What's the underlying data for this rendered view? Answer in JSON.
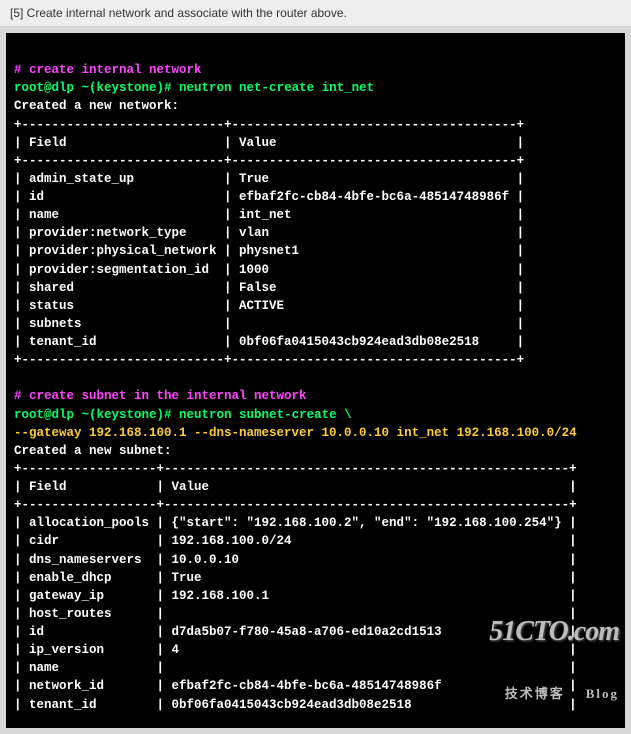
{
  "note": "[5]  Create internal network and associate with the router above.",
  "section1": {
    "comment": "# create internal network",
    "prompt": "root@dlp ~(keystone)#",
    "cmd": "neutron net-create int_net",
    "result_header": "Created a new network:",
    "border_top": "+---------------------------+--------------------------------------+",
    "header": "| Field                     | Value                                |",
    "border_mid": "+---------------------------+--------------------------------------+",
    "r1": "| admin_state_up            | True                                 |",
    "r2": "| id                        | efbaf2fc-cb84-4bfe-bc6a-48514748986f |",
    "r3": "| name                      | int_net                              |",
    "r4": "| provider:network_type     | vlan                                 |",
    "r5": "| provider:physical_network | physnet1                             |",
    "r6": "| provider:segmentation_id  | 1000                                 |",
    "r7": "| shared                    | False                                |",
    "r8": "| status                    | ACTIVE                               |",
    "r9": "| subnets                   |                                      |",
    "r10": "| tenant_id                 | 0bf06fa0415043cb924ead3db08e2518     |",
    "border_bot": "+---------------------------+--------------------------------------+"
  },
  "section2": {
    "comment": "# create subnet in the internal network",
    "prompt": "root@dlp ~(keystone)#",
    "cmd": "neutron subnet-create \\",
    "args": "--gateway 192.168.100.1 --dns-nameserver 10.0.0.10 int_net 192.168.100.0/24",
    "result_header": "Created a new subnet:",
    "border_top": "+------------------+------------------------------------------------------+",
    "header": "| Field            | Value                                                |",
    "border_mid": "+------------------+------------------------------------------------------+",
    "r1": "| allocation_pools | {\"start\": \"192.168.100.2\", \"end\": \"192.168.100.254\"} |",
    "r2": "| cidr             | 192.168.100.0/24                                     |",
    "r3": "| dns_nameservers  | 10.0.0.10                                            |",
    "r4": "| enable_dhcp      | True                                                 |",
    "r5": "| gateway_ip       | 192.168.100.1                                        |",
    "r6": "| host_routes      |                                                      |",
    "r7": "| id               | d7da5b07-f780-45a8-a706-ed10a2cd1513                 |",
    "r8": "| ip_version       | 4                                                    |",
    "r9": "| name             |                                                      |",
    "r10": "| network_id       | efbaf2fc-cb84-4bfe-bc6a-48514748986f                 |",
    "r11": "| tenant_id        | 0bf06fa0415043cb924ead3db08e2518                     |"
  },
  "watermark": {
    "big": "51CTO.com",
    "small": "技术博客    Blog"
  }
}
